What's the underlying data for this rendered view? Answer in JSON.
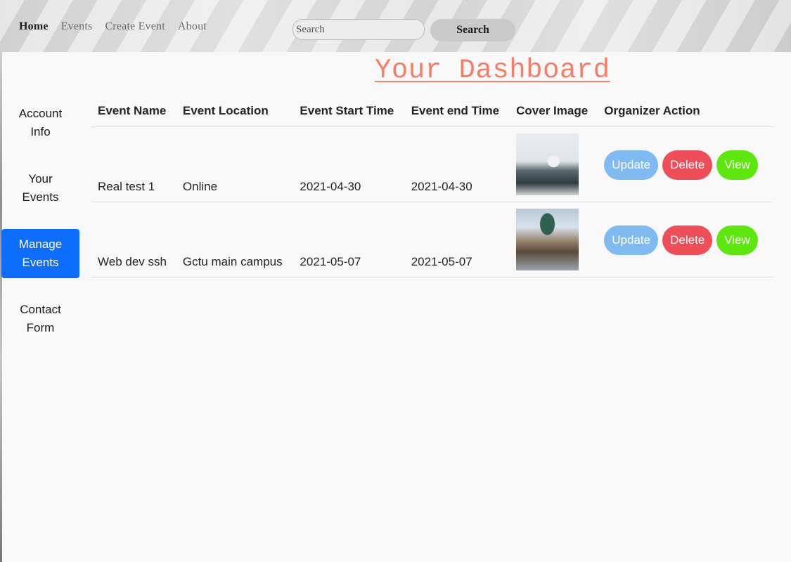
{
  "nav": {
    "links": [
      "Home",
      "Events",
      "Create Event",
      "About"
    ],
    "active": "Home",
    "search": {
      "placeholder": "Search",
      "button_label": "Search"
    }
  },
  "title": "Your Dashboard",
  "sidebar": {
    "items": [
      {
        "label_line1": "Account",
        "label_line2": "Info"
      },
      {
        "label_line1": "Your",
        "label_line2": "Events"
      },
      {
        "label_line1": "Manage",
        "label_line2": "Events",
        "active": true
      },
      {
        "label_line1": "Contact",
        "label_line2": "Form"
      }
    ]
  },
  "table": {
    "headers": [
      "Event Name",
      "Event Location",
      "Event Start Time",
      "Event end Time",
      "Cover Image",
      "Organizer Action"
    ],
    "rows": [
      {
        "name": "Real test 1",
        "location": "Online",
        "start": "2021-04-30",
        "end": "2021-04-30"
      },
      {
        "name": "Web dev ssh",
        "location": "Gctu main campus",
        "start": "2021-05-07",
        "end": "2021-05-07"
      }
    ],
    "actions": {
      "update": "Update",
      "delete": "Delete",
      "view": "View"
    }
  },
  "colors": {
    "accent": "#0d6efd",
    "title": "#f47e66",
    "update": "#7fbaf1",
    "delete": "#ee4e58",
    "view": "#5ee60f"
  }
}
